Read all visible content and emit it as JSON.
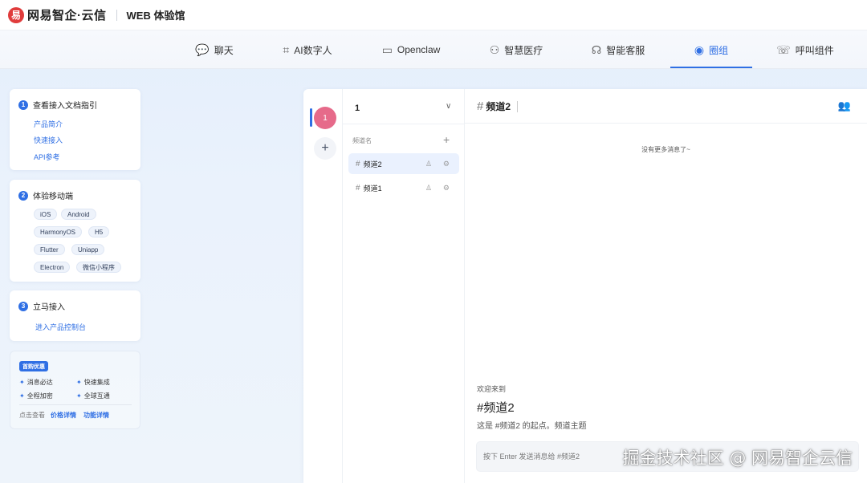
{
  "header": {
    "logo_mark": "易",
    "brand": "网易智企·云信",
    "product": "WEB 体验馆"
  },
  "nav": {
    "items": [
      {
        "icon": "chat-bubbles-icon",
        "glyph": "💬",
        "label": "聊天"
      },
      {
        "icon": "ai-icon",
        "glyph": "⌗",
        "label": "AI数字人"
      },
      {
        "icon": "robot-icon",
        "glyph": "▭",
        "label": "Openclaw"
      },
      {
        "icon": "people-icon",
        "glyph": "⚇",
        "label": "智慧医疗"
      },
      {
        "icon": "headset-icon",
        "glyph": "☊",
        "label": "智能客服"
      },
      {
        "icon": "planet-icon",
        "glyph": "◉",
        "label": "圈组"
      },
      {
        "icon": "phone-icon",
        "glyph": "☏",
        "label": "呼叫组件"
      }
    ],
    "active": "圈组"
  },
  "guide": {
    "docs": {
      "num": "1",
      "title": "查看接入文档指引",
      "links": [
        "产品简介",
        "快速接入",
        "API参考"
      ]
    },
    "mobile": {
      "num": "2",
      "title": "体验移动端",
      "chips": [
        "iOS",
        "Android",
        "HarmonyOS",
        "H5",
        "Flutter",
        "Uniapp",
        "Electron",
        "微信小程序"
      ]
    },
    "access": {
      "num": "3",
      "title": "立马接入",
      "link": "进入产品控制台"
    },
    "promo": {
      "badge": "首购优惠",
      "items": [
        "消息必达",
        "快速集成",
        "全程加密",
        "全球互通"
      ],
      "footer_prefix": "点击查看",
      "footer_links": [
        "价格详情",
        "功能详情"
      ]
    }
  },
  "app": {
    "rail": {
      "avatar_text": "1",
      "add_glyph": "+"
    },
    "server_name": "1",
    "section_label": "频道名",
    "channels": [
      {
        "name": "频道2",
        "active": true
      },
      {
        "name": "频道1",
        "active": false
      }
    ],
    "chat": {
      "title": "频道2",
      "no_more": "没有更多消息了~",
      "welcome": "欢迎来到",
      "welcome_channel": "#频道2",
      "welcome_desc": "这是 #频道2 的起点。频道主题",
      "input_placeholder": "按下 Enter 发送消息给 #频道2"
    }
  },
  "watermark": "掘金技术社区 @ 网易智企云信",
  "colors": {
    "accent": "#2f6fe4",
    "avatar": "#e66a8a",
    "logo": "#e03c3c"
  }
}
